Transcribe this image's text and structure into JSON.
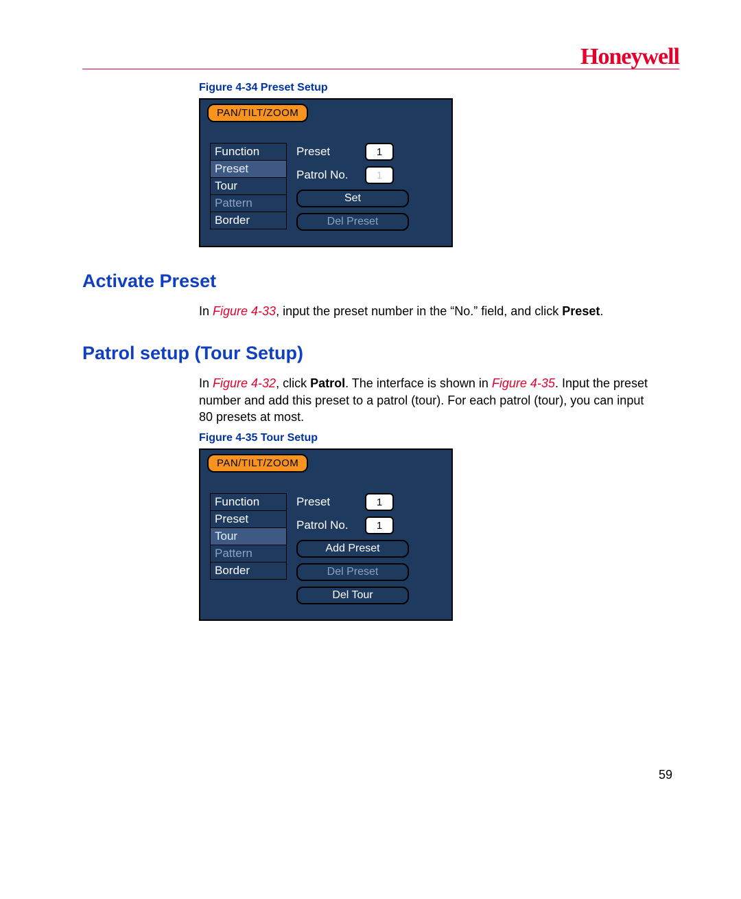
{
  "brand": "Honeywell",
  "page_number": "59",
  "captions": {
    "fig434": "Figure 4-34 Preset Setup",
    "fig435": "Figure 4-35 Tour Setup"
  },
  "headings": {
    "activate_preset": "Activate Preset",
    "patrol_setup": "Patrol setup (Tour Setup)"
  },
  "paragraphs": {
    "p1_a": "In ",
    "p1_ref": "Figure 4-33",
    "p1_b": ", input the preset number in the “No.” field, and click ",
    "p1_bold": "Preset",
    "p1_c": ".",
    "p2_a": "In ",
    "p2_ref1": "Figure 4-32",
    "p2_b": ", click ",
    "p2_bold": "Patrol",
    "p2_c": ". The interface is shown in ",
    "p2_ref2": "Figure 4-35",
    "p2_d": ". Input the preset number and add this preset to a patrol (tour). For each patrol (tour), you can input 80 presets at most."
  },
  "ptz_common": {
    "tab": "PAN/TILT/ZOOM",
    "items": {
      "function": "Function",
      "preset": "Preset",
      "tour": "Tour",
      "pattern": "Pattern",
      "border": "Border"
    },
    "labels": {
      "preset": "Preset",
      "patrol_no": "Patrol No."
    }
  },
  "ptz34": {
    "preset_value": "1",
    "patrol_value": "1",
    "btn_set": "Set",
    "btn_del_preset": "Del Preset"
  },
  "ptz35": {
    "preset_value": "1",
    "patrol_value": "1",
    "btn_add_preset": "Add Preset",
    "btn_del_preset": "Del Preset",
    "btn_del_tour": "Del Tour"
  }
}
